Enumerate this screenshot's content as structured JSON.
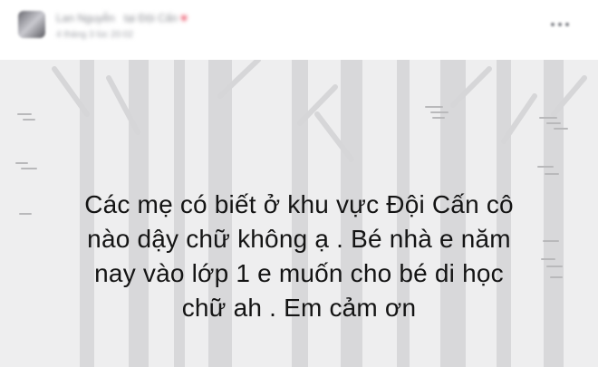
{
  "post": {
    "author_blurred": "Lan Nguyễn",
    "group_blurred": "tại Đội Cấn",
    "time_blurred": "4 tháng 3 lúc 20:02",
    "text_lines": [
      "Các mẹ có biết ở khu vực Đội Cấn cô",
      "nào dậy chữ không ạ . Bé nhà e năm",
      "nay vào lớp 1 e muốn cho bé di học",
      "chữ ah . Em cảm ơn"
    ]
  },
  "icons": {
    "avatar": "avatar-image",
    "heart": "heart-icon",
    "more": "more-options-icon"
  },
  "colors": {
    "background": "#eeeeef",
    "trunk": "#d9d9db",
    "text": "#141414"
  }
}
